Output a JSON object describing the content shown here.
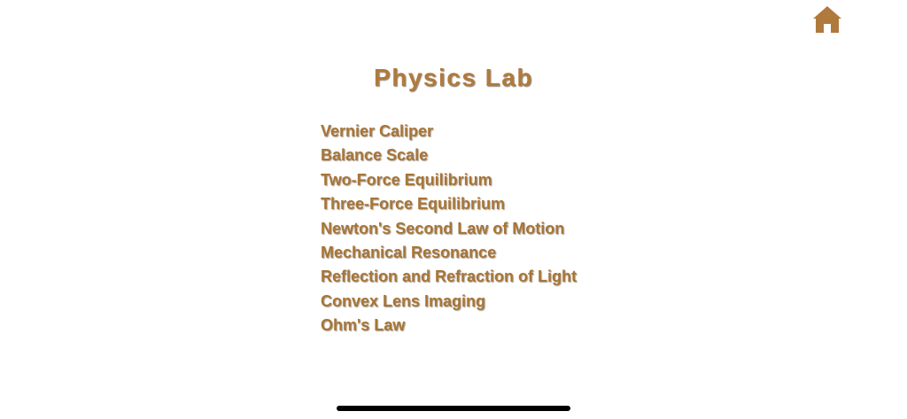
{
  "header": {
    "title": "Physics Lab",
    "home_icon": "home-icon",
    "accent_color": "#b07a3c"
  },
  "experiments": [
    "Vernier Caliper",
    "Balance Scale",
    "Two-Force Equilibrium",
    "Three-Force Equilibrium",
    "Newton's Second Law of Motion",
    "Mechanical Resonance",
    "Reflection and Refraction of Light",
    "Convex Lens Imaging",
    "Ohm's Law"
  ]
}
